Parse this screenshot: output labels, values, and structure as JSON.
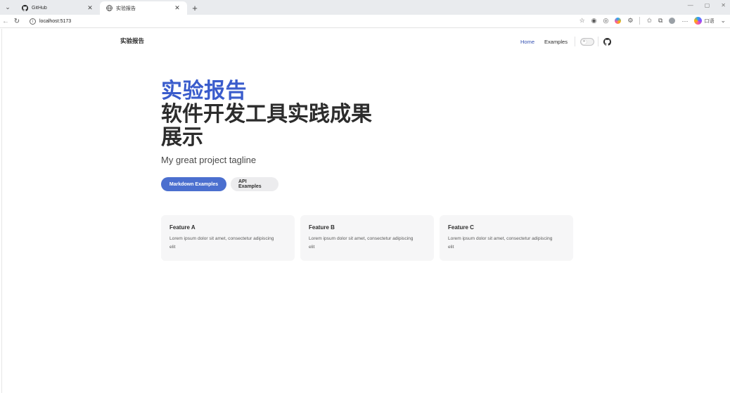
{
  "browser": {
    "tabs": [
      {
        "title": "GitHub",
        "active": false
      },
      {
        "title": "实验报告",
        "active": true
      }
    ],
    "new_tab_label": "+",
    "address": "localhost:5173",
    "copilot_label": "口语"
  },
  "site": {
    "title": "实验报告",
    "nav": [
      {
        "label": "Home",
        "active": true
      },
      {
        "label": "Examples",
        "active": false
      }
    ]
  },
  "hero": {
    "name": "实验报告",
    "text": "软件开发工具实践成果展示",
    "tagline": "My great project tagline",
    "actions": [
      {
        "label": "Markdown Examples",
        "theme": "brand"
      },
      {
        "label": "API Examples",
        "theme": "alt"
      }
    ]
  },
  "features": [
    {
      "title": "Feature A",
      "details": "Lorem ipsum dolor sit amet, consectetur adipiscing elit"
    },
    {
      "title": "Feature B",
      "details": "Lorem ipsum dolor sit amet, consectetur adipiscing elit"
    },
    {
      "title": "Feature C",
      "details": "Lorem ipsum dolor sit amet, consectetur adipiscing elit"
    }
  ],
  "colors": {
    "brand": "#3a5ccc",
    "brand_button": "#4b6fcf",
    "text": "#2c2c2c",
    "card_bg": "#f6f6f7"
  }
}
